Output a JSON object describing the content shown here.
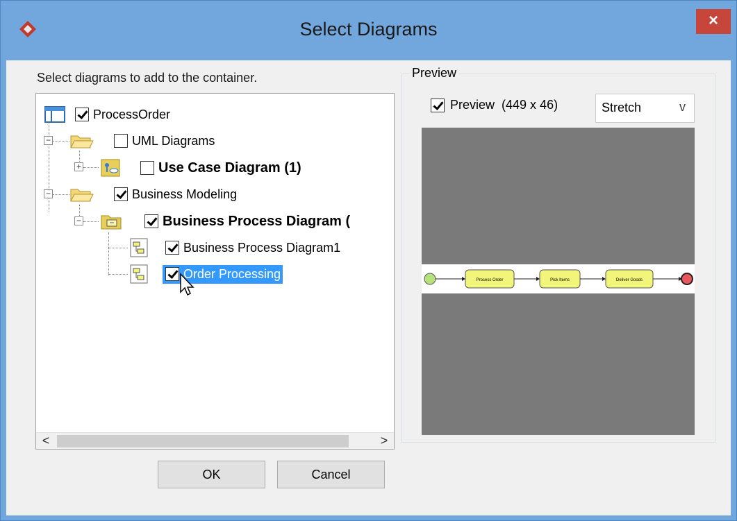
{
  "window": {
    "title": "Select Diagrams",
    "close_glyph": "×",
    "app_icon": "vp-diamond-icon"
  },
  "instruction": "Select diagrams to add to the container.",
  "tree": {
    "nodes": [
      {
        "label": "ProcessOrder",
        "checked": true,
        "icon": "project-icon",
        "bold": false
      },
      {
        "label": "UML Diagrams",
        "checked": false,
        "icon": "folder-open-icon",
        "bold": false
      },
      {
        "label": "Use Case Diagram (1)",
        "checked": false,
        "icon": "use-case-diagram-icon",
        "bold": true
      },
      {
        "label": "Business Modeling",
        "checked": true,
        "icon": "folder-open-icon",
        "bold": false
      },
      {
        "label": "Business Process Diagram (",
        "checked": true,
        "icon": "bpd-folder-icon",
        "bold": true
      },
      {
        "label": "Business Process Diagram1",
        "checked": true,
        "icon": "bpd-diagram-icon",
        "bold": false
      },
      {
        "label": "Order Processing",
        "checked": true,
        "icon": "bpd-diagram-icon",
        "bold": false,
        "selected": true
      }
    ],
    "expander_minus": "−",
    "expander_plus": "+",
    "scroll_left": "<",
    "scroll_right": ">"
  },
  "buttons": {
    "ok": "OK",
    "cancel": "Cancel"
  },
  "preview_group": {
    "title": "Preview",
    "checkbox_label": "Preview",
    "checked": true,
    "size": "(449 x 46)",
    "scale_mode": "Stretch",
    "dropdown_glyph": "v",
    "diagram": {
      "tasks": [
        "Process Order",
        "Pick Items",
        "Deliver Goods"
      ],
      "start_color": "#b7e27b",
      "end_color": "#e8585b",
      "task_color": "#f1f57a"
    }
  },
  "colors": {
    "title_bar": "#72a7dd",
    "close_button": "#c7463b",
    "selection": "#3399ff",
    "preview_background": "#7a7a7a"
  }
}
